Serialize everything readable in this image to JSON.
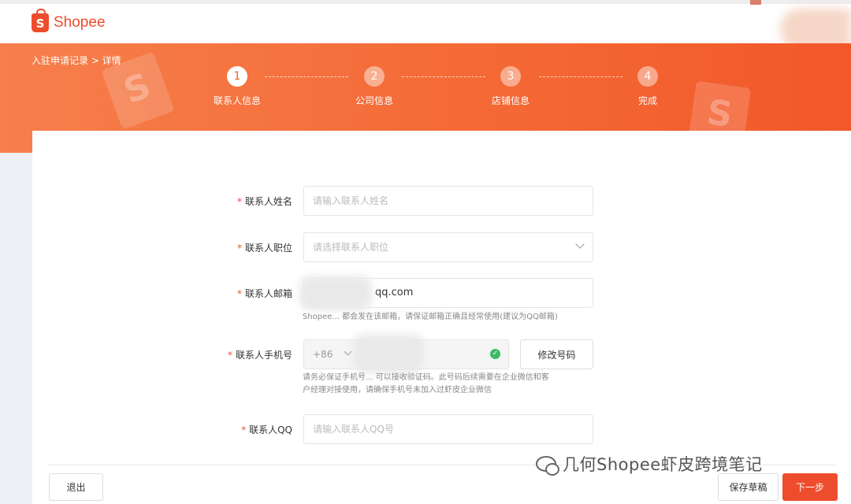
{
  "header": {
    "logo_text": "Shopee"
  },
  "breadcrumb": "入驻申请记录 > 详情",
  "steps": [
    {
      "number": "1",
      "label": "联系人信息",
      "state": "active"
    },
    {
      "number": "2",
      "label": "公司信息",
      "state": "idle"
    },
    {
      "number": "3",
      "label": "店铺信息",
      "state": "idle"
    },
    {
      "number": "4",
      "label": "完成",
      "state": "idle"
    }
  ],
  "form": {
    "name": {
      "label": "联系人姓名",
      "placeholder": "请输入联系人姓名"
    },
    "position": {
      "label": "联系人职位",
      "placeholder": "请选择联系人职位"
    },
    "email": {
      "label": "联系人邮箱",
      "value": "qq.com",
      "hint": "Shopee... 都会发在该邮箱，请保证邮箱正确且经常使用(建议为QQ邮箱)"
    },
    "phone": {
      "label": "联系人手机号",
      "country_code": "+86",
      "change_button": "修改号码",
      "hint_line1": "请务必保证手机号... 可以接收验证码。此号码后续需要在企业微信和客",
      "hint_line2": "户经理对接使用，请确保手机号未加入过虾皮企业微信"
    },
    "qq": {
      "label": "联系人QQ",
      "placeholder": "请输入联系人QQ号"
    },
    "required_mark": "*"
  },
  "footer": {
    "exit_button": "退出",
    "save_draft_button": "保存草稿",
    "next_button": "下一步"
  },
  "watermark": "几何Shopee虾皮跨境笔记",
  "colors": {
    "brand": "#ee4d2d",
    "banner": "#f46a36",
    "success": "#3cba66"
  }
}
